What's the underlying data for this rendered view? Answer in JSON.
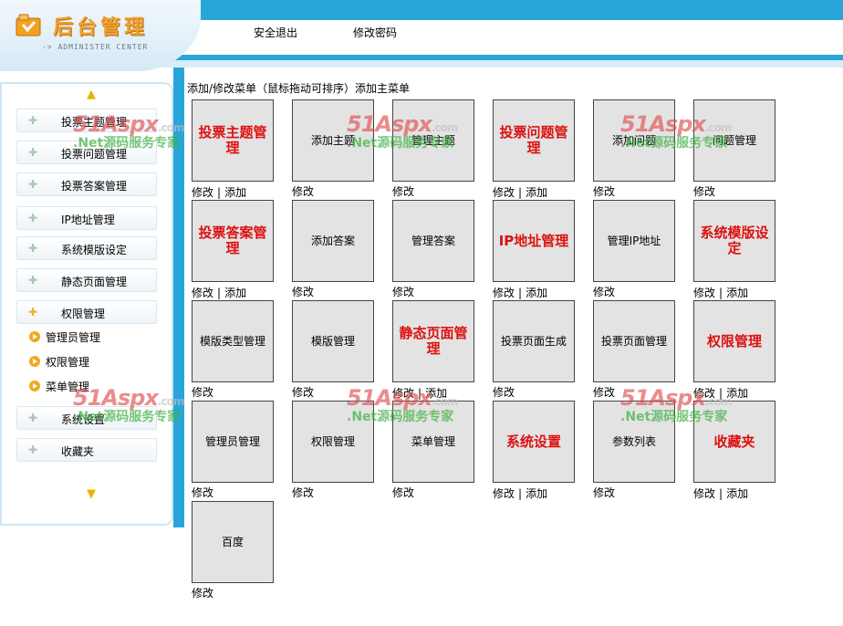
{
  "header": {
    "title": "后台管理",
    "subtitle": "-> ADMINISTER CENTER",
    "links": [
      "安全退出",
      "修改密码"
    ]
  },
  "sidebar": {
    "items": [
      {
        "label": "投票主题管理"
      },
      {
        "label": "投票问题管理"
      },
      {
        "label": "投票答案管理"
      },
      {
        "label": "IP地址管理"
      },
      {
        "label": "系统模版设定"
      },
      {
        "label": "静态页面管理"
      },
      {
        "label": "权限管理"
      },
      {
        "label": "系统设置"
      },
      {
        "label": "收藏夹"
      }
    ],
    "subitems": [
      {
        "label": "管理员管理"
      },
      {
        "label": "权限管理"
      },
      {
        "label": "菜单管理"
      }
    ]
  },
  "main": {
    "heading": "添加/修改菜单（鼠标拖动可排序）添加主菜单",
    "edit_label": "修改",
    "add_label": "添加",
    "separator": "|",
    "tiles": [
      {
        "label": "投票主题管理",
        "main": true
      },
      {
        "label": "添加主题",
        "main": false
      },
      {
        "label": "管理主题",
        "main": false
      },
      {
        "label": "投票问题管理",
        "main": true
      },
      {
        "label": "添加问题",
        "main": false
      },
      {
        "label": "问题管理",
        "main": false
      },
      {
        "label": "投票答案管理",
        "main": true
      },
      {
        "label": "添加答案",
        "main": false
      },
      {
        "label": "管理答案",
        "main": false
      },
      {
        "label": "IP地址管理",
        "main": true
      },
      {
        "label": "管理IP地址",
        "main": false
      },
      {
        "label": "系统模版设定",
        "main": true
      },
      {
        "label": "模版类型管理",
        "main": false
      },
      {
        "label": "模版管理",
        "main": false
      },
      {
        "label": "静态页面管理",
        "main": true
      },
      {
        "label": "投票页面生成",
        "main": false
      },
      {
        "label": "投票页面管理",
        "main": false
      },
      {
        "label": "权限管理",
        "main": true
      },
      {
        "label": "管理员管理",
        "main": false
      },
      {
        "label": "权限管理",
        "main": false
      },
      {
        "label": "菜单管理",
        "main": false
      },
      {
        "label": "系统设置",
        "main": true
      },
      {
        "label": "参数列表",
        "main": false
      },
      {
        "label": "收藏夹",
        "main": true
      },
      {
        "label": "百度",
        "main": false
      }
    ]
  },
  "watermark": {
    "brand": "51Aspx",
    "domain": ".com",
    "slogan": ".Net源码服务专家"
  },
  "colors": {
    "header_blue": "#29a6d9",
    "main_tile_text": "#dd1010",
    "tile_background": "#e3e3e3"
  }
}
